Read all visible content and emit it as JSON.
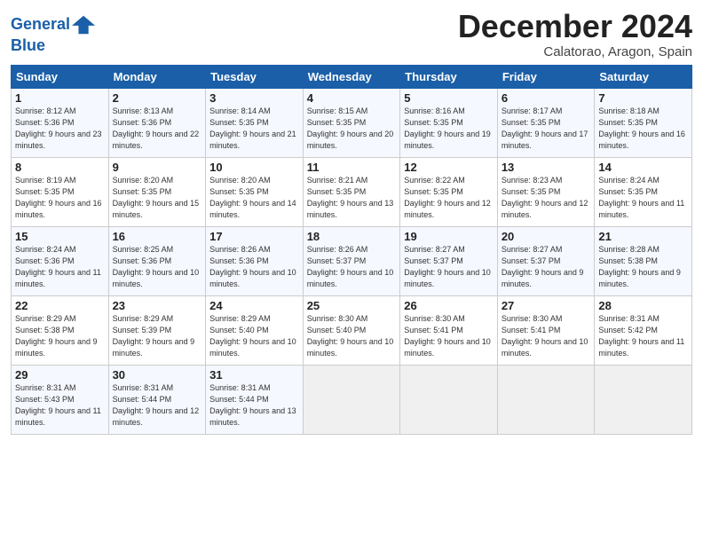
{
  "header": {
    "logo_line1": "General",
    "logo_line2": "Blue",
    "month": "December 2024",
    "location": "Calatorao, Aragon, Spain"
  },
  "weekdays": [
    "Sunday",
    "Monday",
    "Tuesday",
    "Wednesday",
    "Thursday",
    "Friday",
    "Saturday"
  ],
  "weeks": [
    [
      {
        "day": "1",
        "sunrise": "8:12 AM",
        "sunset": "5:36 PM",
        "daylight": "9 hours and 23 minutes."
      },
      {
        "day": "2",
        "sunrise": "8:13 AM",
        "sunset": "5:36 PM",
        "daylight": "9 hours and 22 minutes."
      },
      {
        "day": "3",
        "sunrise": "8:14 AM",
        "sunset": "5:35 PM",
        "daylight": "9 hours and 21 minutes."
      },
      {
        "day": "4",
        "sunrise": "8:15 AM",
        "sunset": "5:35 PM",
        "daylight": "9 hours and 20 minutes."
      },
      {
        "day": "5",
        "sunrise": "8:16 AM",
        "sunset": "5:35 PM",
        "daylight": "9 hours and 19 minutes."
      },
      {
        "day": "6",
        "sunrise": "8:17 AM",
        "sunset": "5:35 PM",
        "daylight": "9 hours and 17 minutes."
      },
      {
        "day": "7",
        "sunrise": "8:18 AM",
        "sunset": "5:35 PM",
        "daylight": "9 hours and 16 minutes."
      }
    ],
    [
      {
        "day": "8",
        "sunrise": "8:19 AM",
        "sunset": "5:35 PM",
        "daylight": "9 hours and 16 minutes."
      },
      {
        "day": "9",
        "sunrise": "8:20 AM",
        "sunset": "5:35 PM",
        "daylight": "9 hours and 15 minutes."
      },
      {
        "day": "10",
        "sunrise": "8:20 AM",
        "sunset": "5:35 PM",
        "daylight": "9 hours and 14 minutes."
      },
      {
        "day": "11",
        "sunrise": "8:21 AM",
        "sunset": "5:35 PM",
        "daylight": "9 hours and 13 minutes."
      },
      {
        "day": "12",
        "sunrise": "8:22 AM",
        "sunset": "5:35 PM",
        "daylight": "9 hours and 12 minutes."
      },
      {
        "day": "13",
        "sunrise": "8:23 AM",
        "sunset": "5:35 PM",
        "daylight": "9 hours and 12 minutes."
      },
      {
        "day": "14",
        "sunrise": "8:24 AM",
        "sunset": "5:35 PM",
        "daylight": "9 hours and 11 minutes."
      }
    ],
    [
      {
        "day": "15",
        "sunrise": "8:24 AM",
        "sunset": "5:36 PM",
        "daylight": "9 hours and 11 minutes."
      },
      {
        "day": "16",
        "sunrise": "8:25 AM",
        "sunset": "5:36 PM",
        "daylight": "9 hours and 10 minutes."
      },
      {
        "day": "17",
        "sunrise": "8:26 AM",
        "sunset": "5:36 PM",
        "daylight": "9 hours and 10 minutes."
      },
      {
        "day": "18",
        "sunrise": "8:26 AM",
        "sunset": "5:37 PM",
        "daylight": "9 hours and 10 minutes."
      },
      {
        "day": "19",
        "sunrise": "8:27 AM",
        "sunset": "5:37 PM",
        "daylight": "9 hours and 10 minutes."
      },
      {
        "day": "20",
        "sunrise": "8:27 AM",
        "sunset": "5:37 PM",
        "daylight": "9 hours and 9 minutes."
      },
      {
        "day": "21",
        "sunrise": "8:28 AM",
        "sunset": "5:38 PM",
        "daylight": "9 hours and 9 minutes."
      }
    ],
    [
      {
        "day": "22",
        "sunrise": "8:29 AM",
        "sunset": "5:38 PM",
        "daylight": "9 hours and 9 minutes."
      },
      {
        "day": "23",
        "sunrise": "8:29 AM",
        "sunset": "5:39 PM",
        "daylight": "9 hours and 9 minutes."
      },
      {
        "day": "24",
        "sunrise": "8:29 AM",
        "sunset": "5:40 PM",
        "daylight": "9 hours and 10 minutes."
      },
      {
        "day": "25",
        "sunrise": "8:30 AM",
        "sunset": "5:40 PM",
        "daylight": "9 hours and 10 minutes."
      },
      {
        "day": "26",
        "sunrise": "8:30 AM",
        "sunset": "5:41 PM",
        "daylight": "9 hours and 10 minutes."
      },
      {
        "day": "27",
        "sunrise": "8:30 AM",
        "sunset": "5:41 PM",
        "daylight": "9 hours and 10 minutes."
      },
      {
        "day": "28",
        "sunrise": "8:31 AM",
        "sunset": "5:42 PM",
        "daylight": "9 hours and 11 minutes."
      }
    ],
    [
      {
        "day": "29",
        "sunrise": "8:31 AM",
        "sunset": "5:43 PM",
        "daylight": "9 hours and 11 minutes."
      },
      {
        "day": "30",
        "sunrise": "8:31 AM",
        "sunset": "5:44 PM",
        "daylight": "9 hours and 12 minutes."
      },
      {
        "day": "31",
        "sunrise": "8:31 AM",
        "sunset": "5:44 PM",
        "daylight": "9 hours and 13 minutes."
      },
      null,
      null,
      null,
      null
    ]
  ]
}
